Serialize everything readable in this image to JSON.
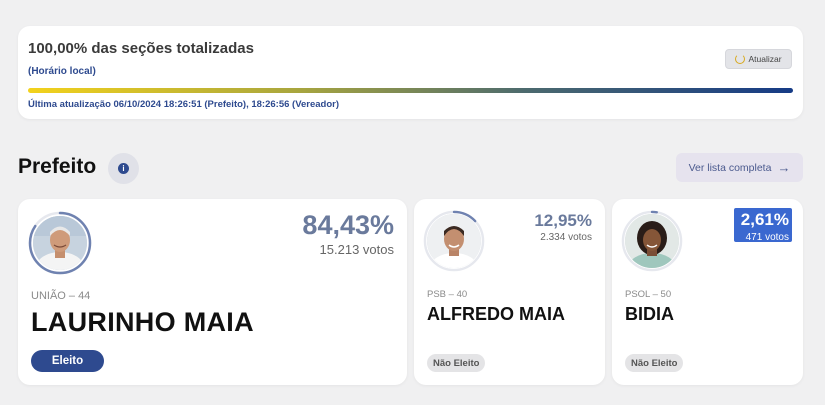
{
  "status": {
    "title": "100,00% das seções totalizadas",
    "local_time_label": "(Horário local)",
    "refresh_label": "Atualizar",
    "progress": 1.0,
    "last_update": "Última atualização 06/10/2024 18:26:51 (Prefeito), 18:26:56 (Vereador)"
  },
  "section": {
    "title": "Prefeito",
    "info_icon": "info-icon",
    "full_list_label": "Ver lista completa",
    "full_list_arrow": "→"
  },
  "candidates": [
    {
      "party": "UNIÃO – 44",
      "name": "LAURINHO MAIA",
      "percent": "84,43%",
      "votes": "15.213 votos",
      "status": "Eleito",
      "share": 0.8443
    },
    {
      "party": "PSB – 40",
      "name": "ALFREDO MAIA",
      "percent": "12,95%",
      "votes": "2.334 votos",
      "status": "Não Eleito",
      "share": 0.1295
    },
    {
      "party": "PSOL – 50",
      "name": "BIDIA",
      "percent": "2,61%",
      "votes": "471 votos",
      "status": "Não Eleito",
      "share": 0.0261
    }
  ],
  "colors": {
    "accent": "#2e4a8f",
    "progress_start": "#f3d21c",
    "progress_end": "#163b86",
    "ring": "#6f82b0",
    "elected_badge": "#2e4a8f",
    "not_elected_badge": "#e4e4e6"
  }
}
